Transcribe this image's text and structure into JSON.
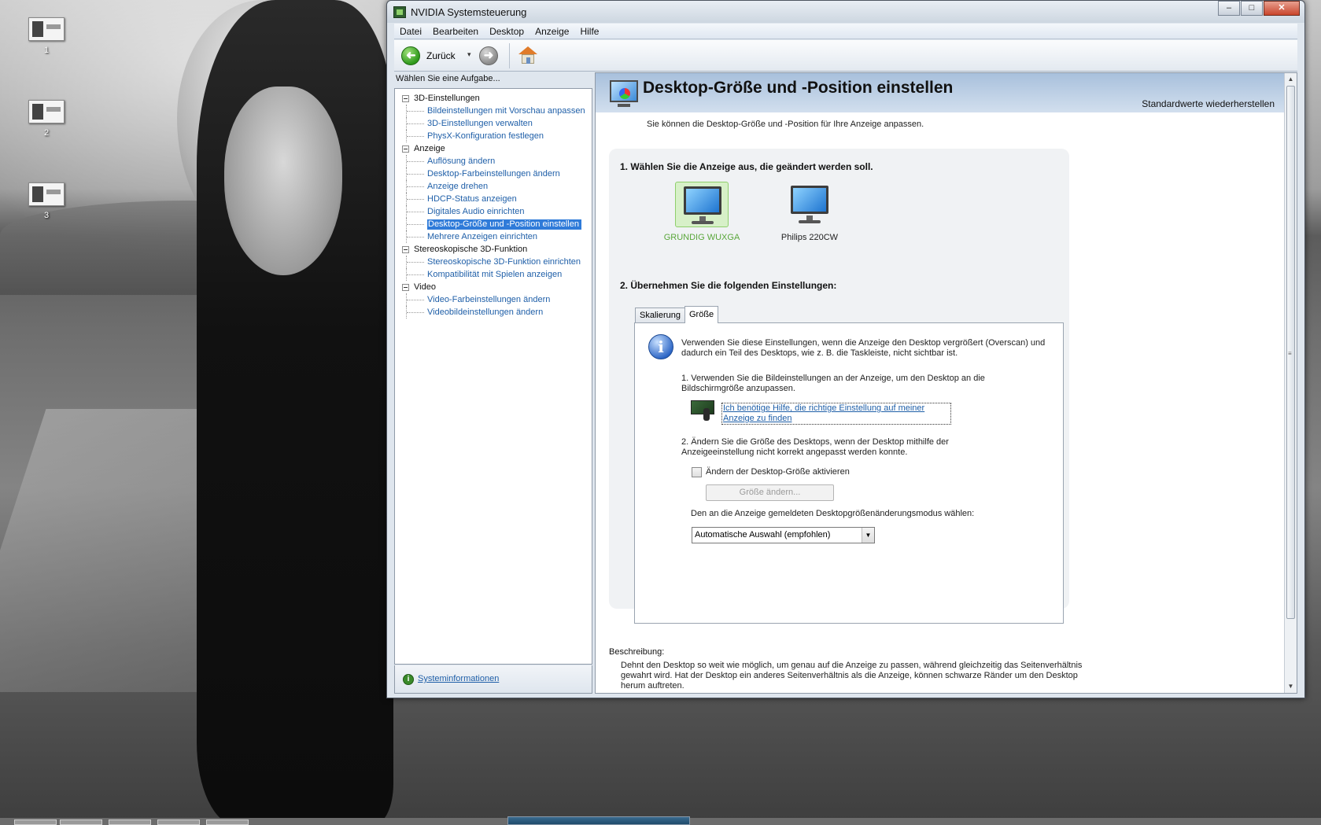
{
  "desktop": {
    "icons": [
      {
        "label": "1"
      },
      {
        "label": "2"
      },
      {
        "label": "3"
      }
    ]
  },
  "window": {
    "title": "NVIDIA Systemsteuerung",
    "caption_buttons": {
      "minimize": "–",
      "maximize": "□",
      "close": "✕"
    }
  },
  "menubar": {
    "items": [
      "Datei",
      "Bearbeiten",
      "Desktop",
      "Anzeige",
      "Hilfe"
    ]
  },
  "toolbar": {
    "back_label": "Zurück",
    "back_glyph": "➜",
    "forward_glyph": "➜",
    "dropdown_glyph": "▾"
  },
  "task_pane": {
    "header": "Wählen Sie eine Aufgabe...",
    "categories": [
      {
        "label": "3D-Einstellungen",
        "items": [
          "Bildeinstellungen mit Vorschau anpassen",
          "3D-Einstellungen verwalten",
          "PhysX-Konfiguration festlegen"
        ]
      },
      {
        "label": "Anzeige",
        "items": [
          "Auflösung ändern",
          "Desktop-Farbeinstellungen ändern",
          "Anzeige drehen",
          "HDCP-Status anzeigen",
          "Digitales Audio einrichten",
          "Desktop-Größe und -Position einstellen",
          "Mehrere Anzeigen einrichten"
        ]
      },
      {
        "label": "Stereoskopische 3D-Funktion",
        "items": [
          "Stereoskopische 3D-Funktion einrichten",
          "Kompatibilität mit Spielen anzeigen"
        ]
      },
      {
        "label": "Video",
        "items": [
          "Video-Farbeinstellungen ändern",
          "Videobildeinstellungen ändern"
        ]
      }
    ],
    "selected_item": "Desktop-Größe und -Position einstellen",
    "sysinfo_link": "Systeminformationen"
  },
  "content": {
    "title": "Desktop-Größe und -Position einstellen",
    "restore_defaults": "Standardwerte wiederherstellen",
    "intro": "Sie können die Desktop-Größe und -Position für Ihre Anzeige anpassen.",
    "step1_heading": "1. Wählen Sie die Anzeige aus, die geändert werden soll.",
    "displays": [
      {
        "name": "GRUNDIG WUXGA",
        "selected": true
      },
      {
        "name": "Philips 220CW",
        "selected": false
      }
    ],
    "step2_heading": "2. Übernehmen Sie die folgenden Einstellungen:",
    "tabs": [
      {
        "label": "Skalierung",
        "active": false
      },
      {
        "label": "Größe",
        "active": true
      }
    ],
    "info_glyph": "i",
    "info_text": "Verwenden Sie diese Einstellungen, wenn die Anzeige den Desktop vergrößert (Overscan) und dadurch ein Teil des Desktops, wie z. B. die Taskleiste, nicht sichtbar ist.",
    "option1_text": "1. Verwenden Sie die Bildeinstellungen an der Anzeige, um den Desktop an die Bildschirmgröße anzupassen.",
    "help_link": "Ich benötige Hilfe, die richtige Einstellung auf meiner Anzeige zu finden",
    "option2_text": "2. Ändern Sie die Größe des Desktops, wenn der Desktop mithilfe der Anzeigeeinstellung nicht korrekt angepasst werden konnte.",
    "resize_checkbox_label": "Ändern der Desktop-Größe aktivieren",
    "resize_checked": false,
    "resize_button": "Größe ändern...",
    "mode_label": "Den an die Anzeige gemeldeten Desktopgrößenänderungsmodus wählen:",
    "mode_selected": "Automatische Auswahl (empfohlen)",
    "description_heading": "Beschreibung:",
    "description_text": "Dehnt den Desktop so weit wie möglich, um genau auf die Anzeige zu passen, während gleichzeitig das Seitenverhältnis gewahrt wird. Hat der Desktop ein anderes Seitenverhältnis als die Anzeige, können schwarze Ränder um den Desktop herum auftreten."
  },
  "scrollbar": {
    "up_glyph": "▲",
    "down_glyph": "▼",
    "grip_glyph": "≡"
  }
}
